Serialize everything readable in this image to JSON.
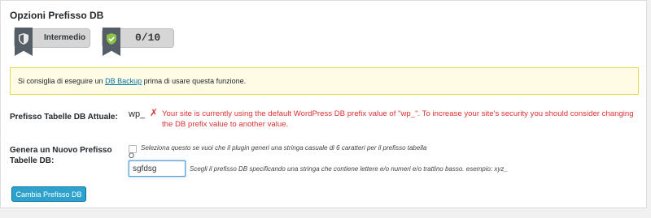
{
  "section": {
    "title": "Opzioni Prefisso DB"
  },
  "badges": {
    "level_label": "Intermedio",
    "score": "0/10"
  },
  "notice": {
    "before_link": "Si consiglia di eseguire un ",
    "link_text": "DB Backup",
    "after_link": " prima di usare questa funzione."
  },
  "current_prefix": {
    "label": "Prefisso Tabelle DB Attuale:",
    "value": "wp_",
    "warning_icon": "x-mark",
    "warning": "Your site is currently using the default WordPress DB prefix value of \"wp_\". To increase your site's security you should consider changing the DB prefix value to another value."
  },
  "new_prefix": {
    "label": "Genera un Nuovo Prefisso Tabelle DB:",
    "checkbox_text": "Seleziona questo se vuoi che il plugin generi una stringa casuale di 6 caratteri per il prefisso tabella",
    "checkbox_checked": false,
    "or_text": "O",
    "input_value": "sgfdsg",
    "input_help": "Scegli il prefisso DB specificando una stringa che contiene lettere e/o numeri e/o trattino basso. esempio: xyz_"
  },
  "actions": {
    "submit_label": "Cambia Prefisso DB"
  },
  "colors": {
    "accent": "#2ea2cc",
    "warning": "#dc3232",
    "notice_bg": "#fffbe5",
    "badge_shield": "#8bc34a"
  }
}
